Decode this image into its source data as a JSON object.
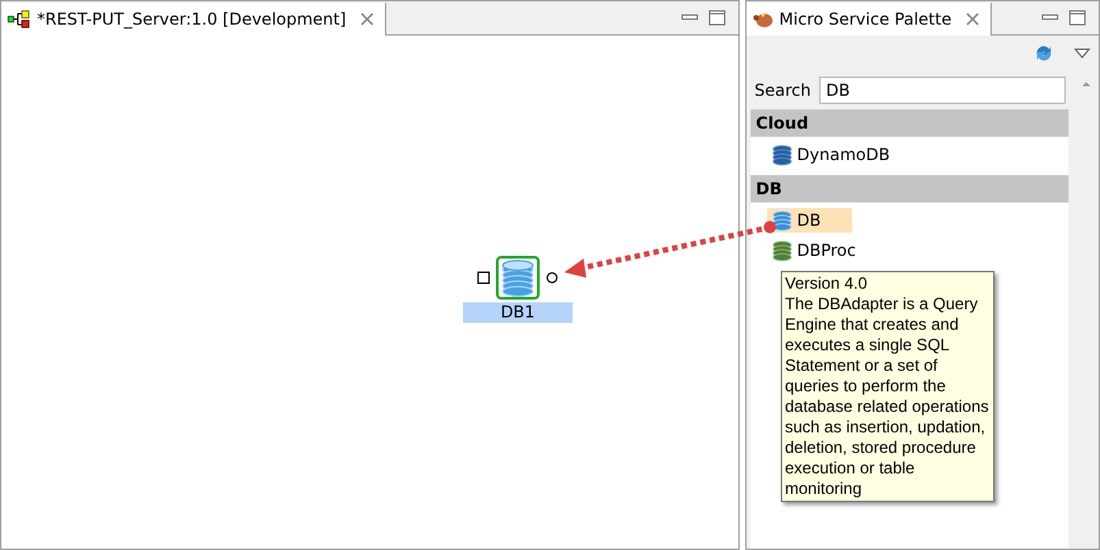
{
  "editor": {
    "tab": {
      "title": "*REST-PUT_Server:1.0 [Development]",
      "selected": true
    },
    "node": {
      "label": "DB1",
      "selected": true
    }
  },
  "palette": {
    "tab": {
      "title": "Micro Service Palette",
      "selected": true
    },
    "search": {
      "label": "Search",
      "value": "DB"
    },
    "groups": [
      {
        "name": "Cloud",
        "items": [
          {
            "label": "DynamoDB",
            "kind": "dynamo",
            "selected": false
          }
        ]
      },
      {
        "name": "DB",
        "items": [
          {
            "label": "DB",
            "kind": "db",
            "selected": true
          },
          {
            "label": "DBProc",
            "kind": "proc",
            "selected": false
          }
        ]
      }
    ],
    "tooltip": {
      "version": "Version 4.0",
      "text": "The DBAdapter is a Query\nEngine that creates and\nexecutes a single SQL\nStatement or a set of\nqueries to perform the\ndatabase related operations\nsuch as insertion, updation,\ndeletion, stored procedure\nexecution or table\nmonitoring"
    }
  }
}
